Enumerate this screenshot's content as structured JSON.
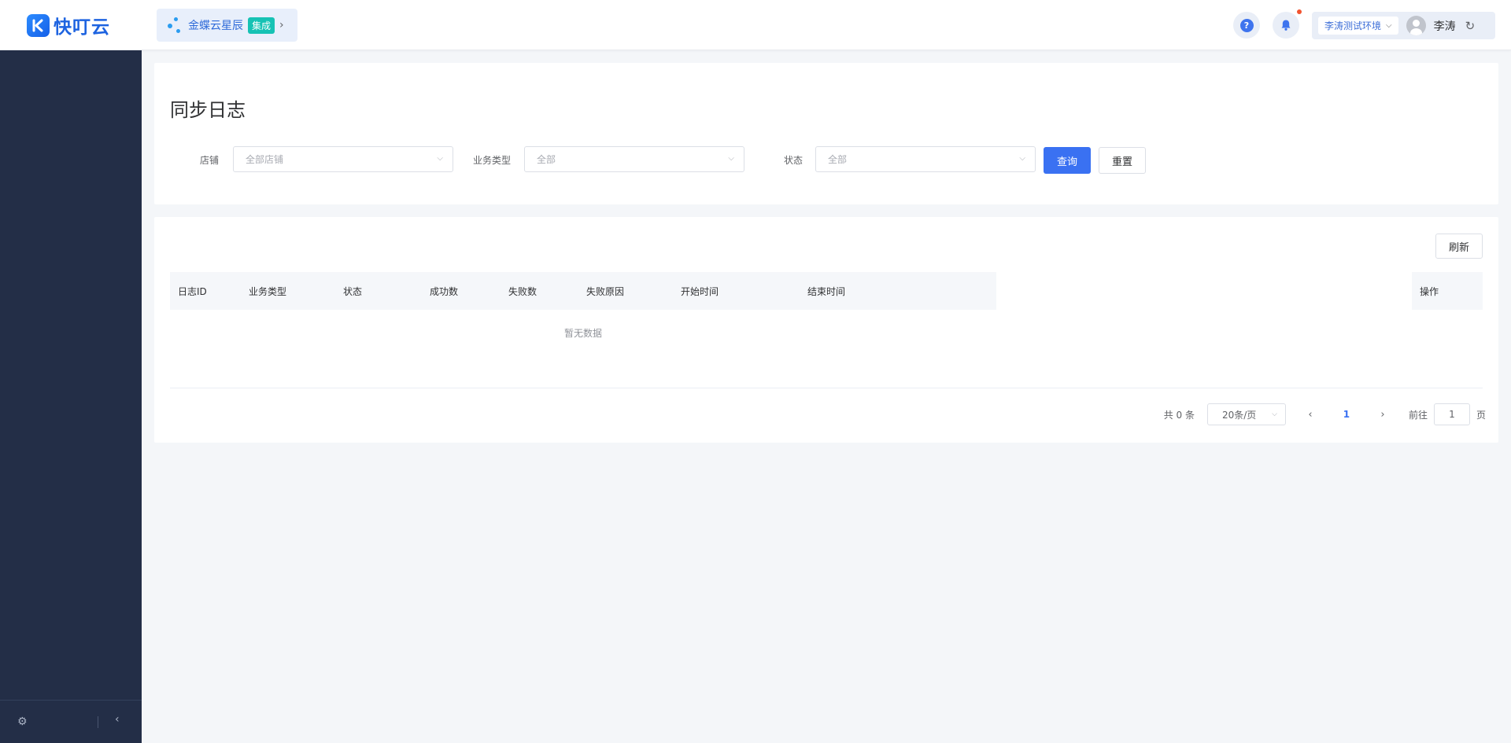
{
  "header": {
    "logo_text": "快叮云",
    "brand": {
      "name": "金蝶云星辰",
      "tag": "集成",
      "arrow": "›"
    },
    "help_glyph": "?",
    "env": {
      "label": "李涛测试环境",
      "chevron": "⌵"
    },
    "user_name": "李涛",
    "refresh_glyph": "↻"
  },
  "sidebar": {
    "gear_glyph": "⚙",
    "collapse_glyph": "‹"
  },
  "page": {
    "title": "同步日志"
  },
  "filters": {
    "shop": {
      "label": "店铺",
      "placeholder": "全部店铺"
    },
    "biz_type": {
      "label": "业务类型",
      "placeholder": "全部"
    },
    "status": {
      "label": "状态",
      "placeholder": "全部"
    },
    "query_label": "查询",
    "reset_label": "重置",
    "chevron": "⌵"
  },
  "table": {
    "refresh_label": "刷新",
    "columns": [
      "日志ID",
      "业务类型",
      "状态",
      "成功数",
      "失败数",
      "失败原因",
      "开始时间",
      "结束时间"
    ],
    "action_column": "操作",
    "empty_text": "暂无数据"
  },
  "pagination": {
    "total": "共 0 条",
    "page_size": "20条/页",
    "prev": "‹",
    "current": "1",
    "next": "›",
    "goto_label": "前往",
    "goto_value": "1",
    "goto_suffix": "页"
  },
  "colors": {
    "primary": "#3a71f2",
    "sidebar": "#232e47",
    "brand_tag": "#16c2b4",
    "notice_dot": "#f2532f"
  }
}
